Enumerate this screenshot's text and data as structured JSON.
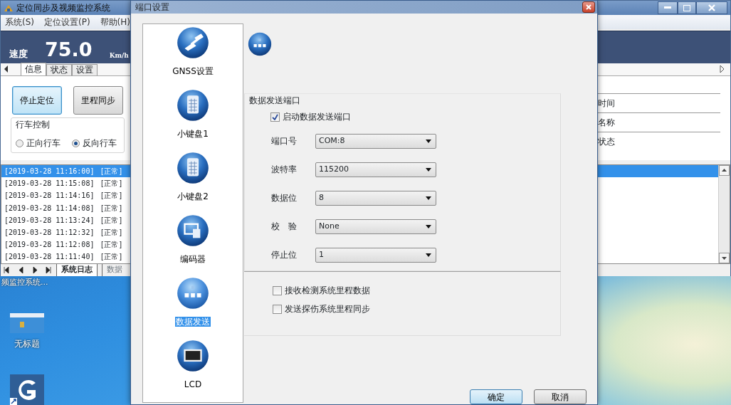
{
  "main_window": {
    "title": "定位同步及视频监控系统",
    "menu": [
      "系统(S)",
      "定位设置(P)",
      "帮助(H)"
    ],
    "speed": {
      "label": "速度",
      "value": "75.0",
      "unit": "Km/h"
    },
    "tabs": [
      {
        "label": "信息",
        "selected": true
      },
      {
        "label": "状态",
        "selected": false
      },
      {
        "label": "设置",
        "selected": false
      }
    ],
    "buttons": [
      {
        "label": "停止定位",
        "focused": true
      },
      {
        "label": "里程同步",
        "focused": false
      }
    ],
    "drive_control": {
      "title": "行车控制",
      "options": [
        {
          "label": "正向行车",
          "selected": false
        },
        {
          "label": "反向行车",
          "selected": true
        }
      ]
    },
    "info_rows": [
      "时间",
      "名称",
      "状态"
    ],
    "log": [
      {
        "time": "[2019-03-28 11:16:00]",
        "status": "[正常]",
        "selected": true
      },
      {
        "time": "[2019-03-28 11:15:08]",
        "status": "[正常]",
        "selected": false
      },
      {
        "time": "[2019-03-28 11:14:16]",
        "status": "[正常]",
        "selected": false
      },
      {
        "time": "[2019-03-28 11:14:08]",
        "status": "[正常]",
        "selected": false
      },
      {
        "time": "[2019-03-28 11:13:24]",
        "status": "[正常]",
        "selected": false
      },
      {
        "time": "[2019-03-28 11:12:32]",
        "status": "[正常]",
        "selected": false
      },
      {
        "time": "[2019-03-28 11:12:08]",
        "status": "[正常]",
        "selected": false
      },
      {
        "time": "[2019-03-28 11:11:40]",
        "status": "[正常]",
        "selected": false
      }
    ],
    "bottom_tabs": [
      {
        "label": "系统日志",
        "selected": true
      },
      {
        "label": "数据",
        "selected": false
      }
    ]
  },
  "desktop": {
    "caption": "频监控系统...",
    "icons": [
      {
        "kind": "window",
        "label": "无标题"
      },
      {
        "kind": "app"
      }
    ]
  },
  "dialog": {
    "title": "端口设置",
    "nav": [
      {
        "label": "GNSS设置",
        "kind": "satellite",
        "selected": false
      },
      {
        "label": "小键盘1",
        "kind": "keypad",
        "selected": false
      },
      {
        "label": "小键盘2",
        "kind": "keypad",
        "selected": false
      },
      {
        "label": "编码器",
        "kind": "encoder",
        "selected": false
      },
      {
        "label": "数据发送",
        "kind": "network",
        "selected": true
      },
      {
        "label": "LCD",
        "kind": "monitor",
        "selected": false
      }
    ],
    "group_title": "数据发送端口",
    "enable": {
      "label": "启动数据发送端口",
      "checked": true
    },
    "fields": [
      {
        "label": "端口号",
        "value": "COM:8"
      },
      {
        "label": "波特率",
        "value": "115200"
      },
      {
        "label": "数据位",
        "value": "8"
      },
      {
        "label": "校　验",
        "value": "None"
      },
      {
        "label": "停止位",
        "value": "1"
      }
    ],
    "options": [
      {
        "label": "接收检测系统里程数据",
        "checked": false
      },
      {
        "label": "发送探伤系统里程同步",
        "checked": false
      }
    ],
    "buttons": [
      {
        "label": "确定",
        "kind": "default"
      },
      {
        "label": "取消",
        "kind": "normal"
      }
    ]
  }
}
